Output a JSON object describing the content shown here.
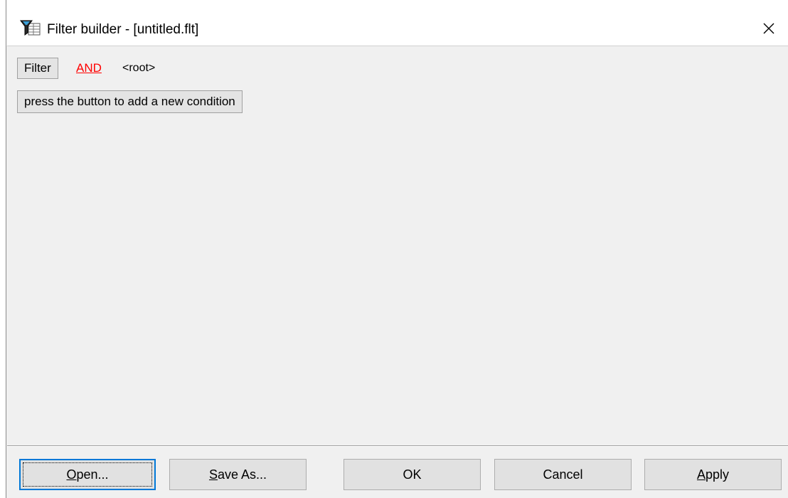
{
  "window": {
    "title": "Filter builder - [untitled.flt]",
    "icon": "filter-funnel-icon",
    "close_glyph": "✕"
  },
  "filter": {
    "filter_button_label": "Filter",
    "operator_label": "AND",
    "operator_color": "#ff0000",
    "root_label": "<root>",
    "add_condition_label": "press the button to add a new condition"
  },
  "buttons": {
    "open": {
      "accel": "O",
      "rest": "pen..."
    },
    "save_as": {
      "accel": "S",
      "rest": "ave As..."
    },
    "ok": "OK",
    "cancel": "Cancel",
    "apply": {
      "accel": "A",
      "rest": "pply"
    }
  },
  "colors": {
    "focus_accent": "#0078d7",
    "background": "#f0f0f0"
  }
}
